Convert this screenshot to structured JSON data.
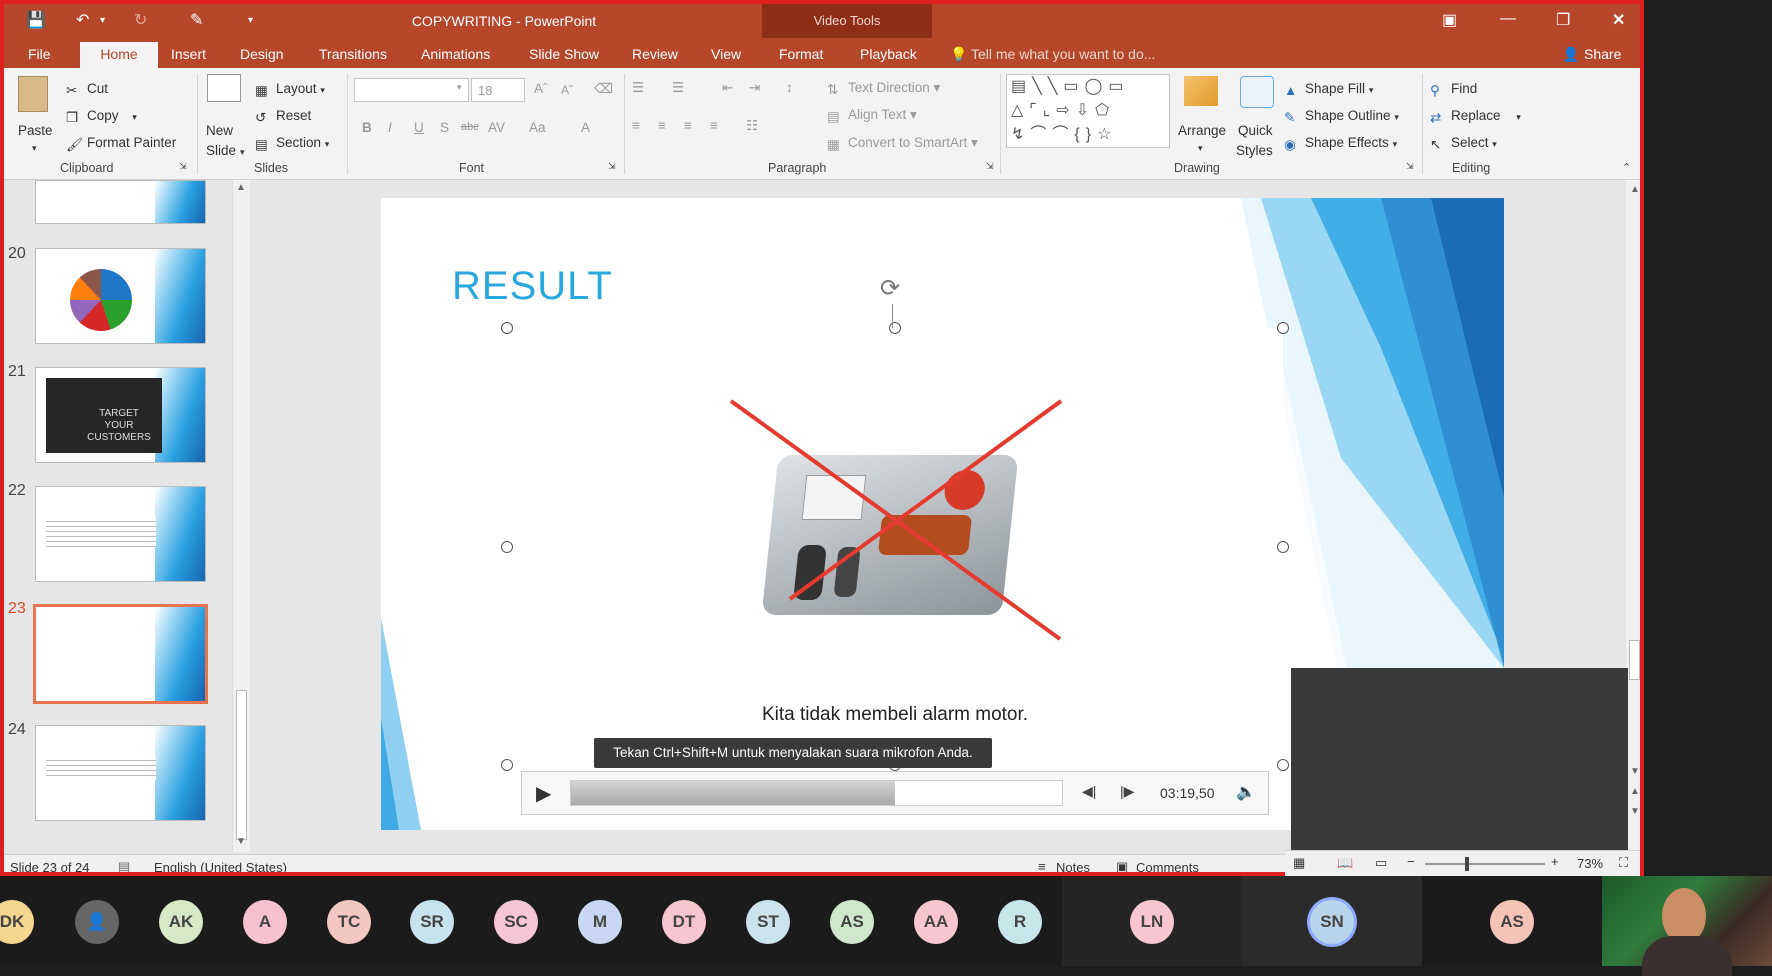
{
  "window": {
    "title": "COPYWRITING - PowerPoint",
    "context_tab": "Video Tools"
  },
  "tabs": [
    "File",
    "Home",
    "Insert",
    "Design",
    "Transitions",
    "Animations",
    "Slide Show",
    "Review",
    "View",
    "Format",
    "Playback"
  ],
  "tell_me": "Tell me what you want to do...",
  "share": "Share",
  "clipboard": {
    "paste": "Paste",
    "cut": "Cut",
    "copy": "Copy",
    "format_painter": "Format Painter",
    "group": "Clipboard"
  },
  "slides_group": {
    "new_slide": "New",
    "new_slide2": "Slide",
    "layout": "Layout",
    "reset": "Reset",
    "section": "Section",
    "group": "Slides"
  },
  "font": {
    "size": "18",
    "group": "Font"
  },
  "paragraph": {
    "text_direction": "Text Direction",
    "align_text": "Align Text",
    "convert": "Convert to SmartArt",
    "group": "Paragraph"
  },
  "drawing": {
    "arrange": "Arrange",
    "quick": "Quick",
    "styles": "Styles",
    "shape_fill": "Shape Fill",
    "shape_outline": "Shape Outline",
    "shape_effects": "Shape Effects",
    "group": "Drawing"
  },
  "editing": {
    "find": "Find",
    "replace": "Replace",
    "select": "Select",
    "group": "Editing"
  },
  "thumbs": [
    {
      "num": "20"
    },
    {
      "num": "21",
      "text": "TARGET YOUR CUSTOMERS"
    },
    {
      "num": "22"
    },
    {
      "num": "23",
      "selected": true
    },
    {
      "num": "24"
    }
  ],
  "slide": {
    "title": "RESULT",
    "caption": "Kita tidak membeli alarm motor."
  },
  "tooltip": "Tekan Ctrl+Shift+M untuk menyalakan suara mikrofon Anda.",
  "player": {
    "time": "03:19,50",
    "progress": 0.66
  },
  "status": {
    "slide": "Slide 23 of 24",
    "language": "English (United States)",
    "notes": "Notes",
    "comments": "Comments",
    "zoom": "73%"
  },
  "participants": [
    "DK",
    "",
    "AK",
    "A",
    "TC",
    "SR",
    "SC",
    "M",
    "DT",
    "ST",
    "AS",
    "AA",
    "R",
    "LN",
    "SN",
    "AS"
  ],
  "colors": {
    "accent": "#b7472a",
    "slide_title": "#29a7df",
    "border": "#e02020"
  }
}
